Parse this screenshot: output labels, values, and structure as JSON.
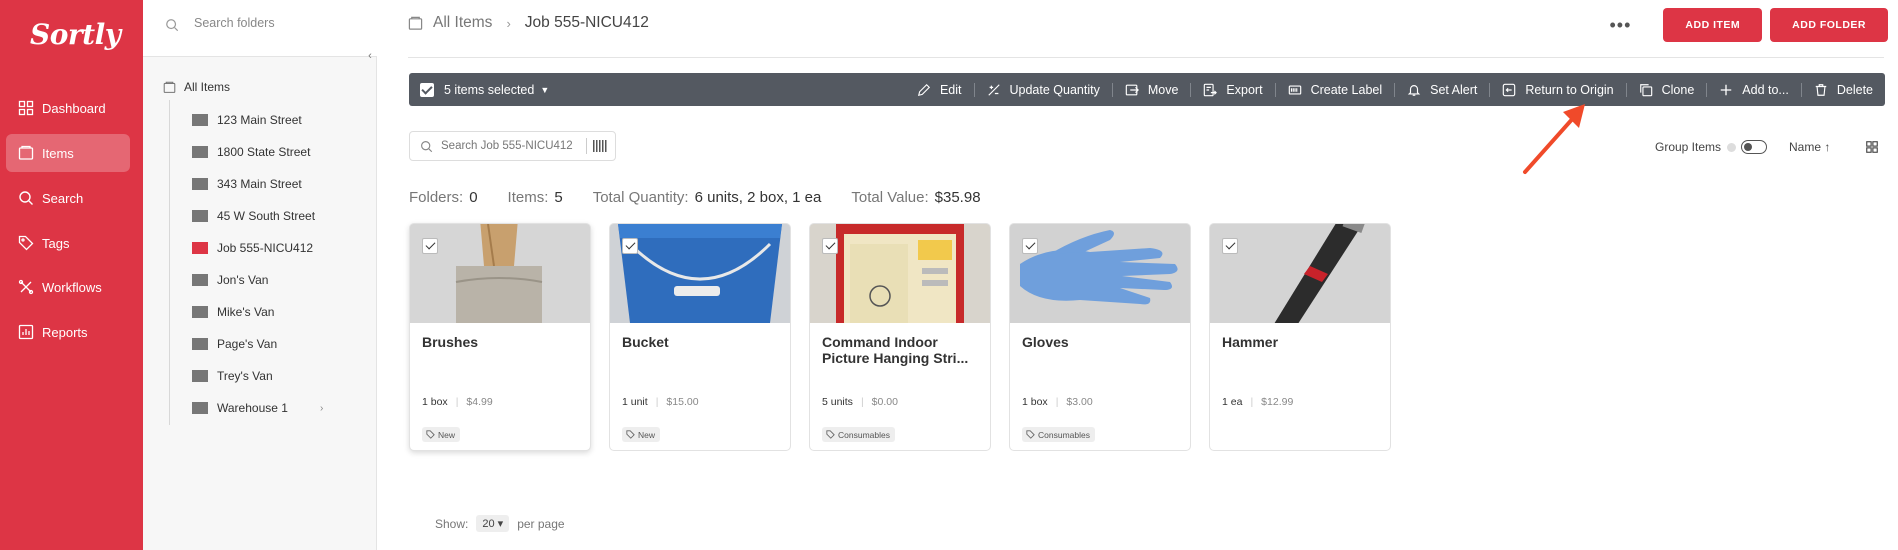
{
  "brand": {
    "logo_text": "Sortly",
    "accent": "#dd3545"
  },
  "nav": {
    "items": [
      {
        "label": "Dashboard",
        "icon": "dashboard-icon"
      },
      {
        "label": "Items",
        "icon": "items-icon",
        "active": true
      },
      {
        "label": "Search",
        "icon": "search-icon"
      },
      {
        "label": "Tags",
        "icon": "tag-icon"
      },
      {
        "label": "Workflows",
        "icon": "workflows-icon"
      },
      {
        "label": "Reports",
        "icon": "reports-icon"
      }
    ]
  },
  "folders": {
    "search_placeholder": "Search folders",
    "root_label": "All Items",
    "items": [
      {
        "label": "123 Main Street",
        "color": "#777777"
      },
      {
        "label": "1800 State Street",
        "color": "#777777"
      },
      {
        "label": "343 Main Street",
        "color": "#777777"
      },
      {
        "label": "45 W South Street",
        "color": "#777777"
      },
      {
        "label": "Job 555-NICU412",
        "color": "#dd3545",
        "active": true
      },
      {
        "label": "Jon's Van",
        "color": "#777777"
      },
      {
        "label": "Mike's Van",
        "color": "#777777"
      },
      {
        "label": "Page's Van",
        "color": "#777777"
      },
      {
        "label": "Trey's Van",
        "color": "#777777"
      },
      {
        "label": "Warehouse 1",
        "color": "#777777",
        "expandable": true
      }
    ]
  },
  "header": {
    "breadcrumb_root": "All Items",
    "breadcrumb_current": "Job 555-NICU412",
    "more_label": "•••",
    "add_item_label": "ADD ITEM",
    "add_folder_label": "ADD FOLDER"
  },
  "actionbar": {
    "selected_label": "5 items selected",
    "actions": [
      {
        "label": "Edit",
        "icon": "pencil-icon"
      },
      {
        "label": "Update Quantity",
        "icon": "quantity-icon"
      },
      {
        "label": "Move",
        "icon": "move-icon"
      },
      {
        "label": "Export",
        "icon": "export-icon"
      },
      {
        "label": "Create Label",
        "icon": "label-icon"
      },
      {
        "label": "Set Alert",
        "icon": "bell-icon"
      },
      {
        "label": "Return to Origin",
        "icon": "return-icon"
      },
      {
        "label": "Clone",
        "icon": "clone-icon"
      },
      {
        "label": "Add to...",
        "icon": "plus-icon"
      },
      {
        "label": "Delete",
        "icon": "trash-icon"
      }
    ]
  },
  "toolbar": {
    "search_placeholder": "Search Job 555-NICU412",
    "group_items_label": "Group Items",
    "sort_label": "Name ↑"
  },
  "summary": {
    "folders_label": "Folders:",
    "folders_value": "0",
    "items_label": "Items:",
    "items_value": "5",
    "qty_label": "Total Quantity:",
    "qty_value": "6 units, 2 box, 1 ea",
    "value_label": "Total Value:",
    "value_value": "$35.98"
  },
  "cards": [
    {
      "name": "Brushes",
      "qty": "1 box",
      "price": "$4.99",
      "tag": "New",
      "selected": true
    },
    {
      "name": "Bucket",
      "qty": "1 unit",
      "price": "$15.00",
      "tag": "New",
      "selected": true
    },
    {
      "name": "Command Indoor Picture Hanging Stri...",
      "qty": "5 units",
      "price": "$0.00",
      "tag": "Consumables",
      "selected": true
    },
    {
      "name": "Gloves",
      "qty": "1 box",
      "price": "$3.00",
      "tag": "Consumables",
      "selected": true
    },
    {
      "name": "Hammer",
      "qty": "1 ea",
      "price": "$12.99",
      "tag": "",
      "selected": true
    }
  ],
  "pager": {
    "show_label": "Show:",
    "page_size": "20",
    "per_page_label": "per page"
  }
}
